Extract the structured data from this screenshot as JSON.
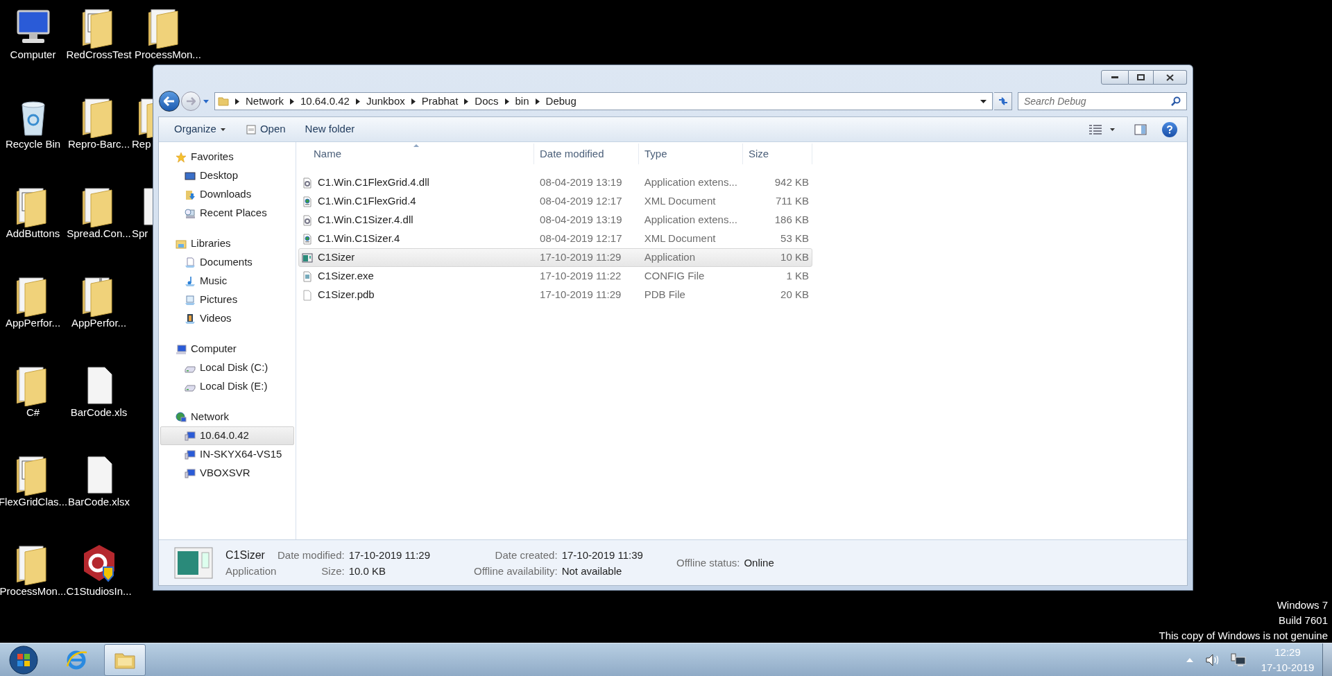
{
  "desktop": {
    "columns": [
      [
        {
          "label": "Computer",
          "kind": "computer"
        },
        {
          "label": "Recycle Bin",
          "kind": "recycle-bin"
        },
        {
          "label": "AddButtons",
          "kind": "project-folder"
        },
        {
          "label": "AppPerfor...",
          "kind": "folder"
        },
        {
          "label": "C#",
          "kind": "folder"
        },
        {
          "label": "FlexGridClas...",
          "kind": "project-folder"
        },
        {
          "label": "ProcessMon...",
          "kind": "folder"
        }
      ],
      [
        {
          "label": "RedCrossTest",
          "kind": "project-folder"
        },
        {
          "label": "Repro-Barc...",
          "kind": "folder"
        },
        {
          "label": "Spread.Con...",
          "kind": "folder"
        },
        {
          "label": "AppPerfor...",
          "kind": "zip-folder"
        },
        {
          "label": "BarCode.xls",
          "kind": "file"
        },
        {
          "label": "BarCode.xlsx",
          "kind": "file"
        },
        {
          "label": "C1StudiosIn...",
          "kind": "installer"
        }
      ],
      [
        {
          "label": "ProcessMon...",
          "kind": "folder"
        },
        {
          "label": "Rep",
          "kind": "folder"
        },
        {
          "label": "Spr",
          "kind": "file"
        }
      ]
    ]
  },
  "window": {
    "address": {
      "crumbs": [
        "Network",
        "10.64.0.42",
        "Junkbox",
        "Prabhat",
        "Docs",
        "bin",
        "Debug"
      ]
    },
    "search": {
      "placeholder": "Search Debug"
    },
    "toolbar": {
      "organize": "Organize",
      "open": "Open",
      "new_folder": "New folder"
    },
    "nav": [
      {
        "label": "Favorites",
        "kind": "star",
        "children": [
          {
            "label": "Desktop",
            "kind": "desktop",
            "selected": false
          },
          {
            "label": "Downloads",
            "kind": "downloads",
            "selected": false
          },
          {
            "label": "Recent Places",
            "kind": "recent",
            "selected": false
          }
        ]
      },
      {
        "label": "Libraries",
        "kind": "library",
        "children": [
          {
            "label": "Documents",
            "kind": "documents",
            "selected": false
          },
          {
            "label": "Music",
            "kind": "music",
            "selected": false
          },
          {
            "label": "Pictures",
            "kind": "pictures",
            "selected": false
          },
          {
            "label": "Videos",
            "kind": "videos",
            "selected": false
          }
        ]
      },
      {
        "label": "Computer",
        "kind": "computer",
        "children": [
          {
            "label": "Local Disk (C:)",
            "kind": "disk",
            "selected": false
          },
          {
            "label": "Local Disk (E:)",
            "kind": "disk",
            "selected": false
          }
        ]
      },
      {
        "label": "Network",
        "kind": "network",
        "children": [
          {
            "label": "10.64.0.42",
            "kind": "pc",
            "selected": true
          },
          {
            "label": "IN-SKYX64-VS15",
            "kind": "pc",
            "selected": false
          },
          {
            "label": "VBOXSVR",
            "kind": "pc",
            "selected": false
          }
        ]
      }
    ],
    "files": {
      "columns": [
        {
          "label": "Name",
          "sorted": true
        },
        {
          "label": "Date modified",
          "sorted": false
        },
        {
          "label": "Type",
          "sorted": false
        },
        {
          "label": "Size",
          "sorted": false
        }
      ],
      "rows": [
        {
          "name": "C1.Win.C1FlexGrid.4.dll",
          "date": "08-04-2019 13:19",
          "type": "Application extens...",
          "size": "942 KB",
          "kind": "dll",
          "selected": false
        },
        {
          "name": "C1.Win.C1FlexGrid.4",
          "date": "08-04-2019 12:17",
          "type": "XML Document",
          "size": "711 KB",
          "kind": "xml",
          "selected": false
        },
        {
          "name": "C1.Win.C1Sizer.4.dll",
          "date": "08-04-2019 13:19",
          "type": "Application extens...",
          "size": "186 KB",
          "kind": "dll",
          "selected": false
        },
        {
          "name": "C1.Win.C1Sizer.4",
          "date": "08-04-2019 12:17",
          "type": "XML Document",
          "size": "53 KB",
          "kind": "xml",
          "selected": false
        },
        {
          "name": "C1Sizer",
          "date": "17-10-2019 11:29",
          "type": "Application",
          "size": "10 KB",
          "kind": "app",
          "selected": true
        },
        {
          "name": "C1Sizer.exe",
          "date": "17-10-2019 11:22",
          "type": "CONFIG File",
          "size": "1 KB",
          "kind": "config",
          "selected": false
        },
        {
          "name": "C1Sizer.pdb",
          "date": "17-10-2019 11:29",
          "type": "PDB File",
          "size": "20 KB",
          "kind": "pdb",
          "selected": false
        }
      ]
    },
    "details": {
      "name": "C1Sizer",
      "type": "Application",
      "groups": [
        [
          {
            "label": "Date modified:",
            "value": "17-10-2019 11:29"
          },
          {
            "label": "Size:",
            "value": "10.0 KB"
          }
        ],
        [
          {
            "label": "Date created:",
            "value": "17-10-2019 11:39"
          },
          {
            "label": "Offline availability:",
            "value": "Not available"
          }
        ],
        [
          {
            "label": "Offline status:",
            "value": "Online"
          }
        ]
      ]
    }
  },
  "notice": [
    "Windows 7",
    "Build 7601",
    "This copy of Windows is not genuine"
  ],
  "taskbar": {
    "apps": [
      {
        "kind": "ie",
        "active": false
      },
      {
        "kind": "explorer",
        "active": true
      }
    ],
    "clock": {
      "time": "12:29",
      "date": "17-10-2019"
    }
  }
}
